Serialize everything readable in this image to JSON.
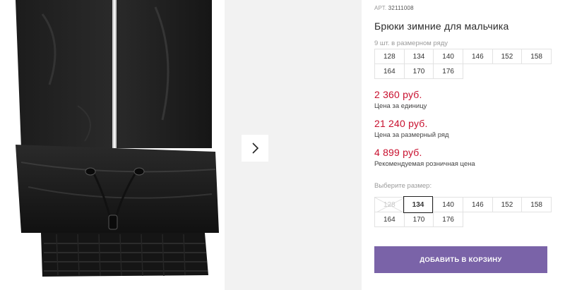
{
  "product": {
    "art_label": "АРТ.",
    "art_value": "32111008",
    "title": "Брюки зимние для мальчика",
    "row_note": "9 шт. в размерном ряду",
    "row_sizes": [
      "128",
      "134",
      "140",
      "146",
      "152",
      "158",
      "164",
      "170",
      "176"
    ]
  },
  "prices": [
    {
      "value": "2 360 руб.",
      "label": "Цена за единицу"
    },
    {
      "value": "21 240 руб.",
      "label": "Цена за размерный ряд"
    },
    {
      "value": "4 899 руб.",
      "label": "Рекомендуемая розничная цена"
    }
  ],
  "size_picker": {
    "label": "Выберите размер:",
    "sizes": [
      "128",
      "134",
      "140",
      "146",
      "152",
      "158",
      "164",
      "170",
      "176"
    ],
    "selected": "134",
    "unavailable": [
      "128"
    ]
  },
  "cart_button": {
    "label": "ДОБАВИТЬ В КОРЗИНУ",
    "color": "#7a63a8"
  },
  "price_color": "#c8102e",
  "gallery": {
    "next_icon": "chevron-right-icon"
  }
}
